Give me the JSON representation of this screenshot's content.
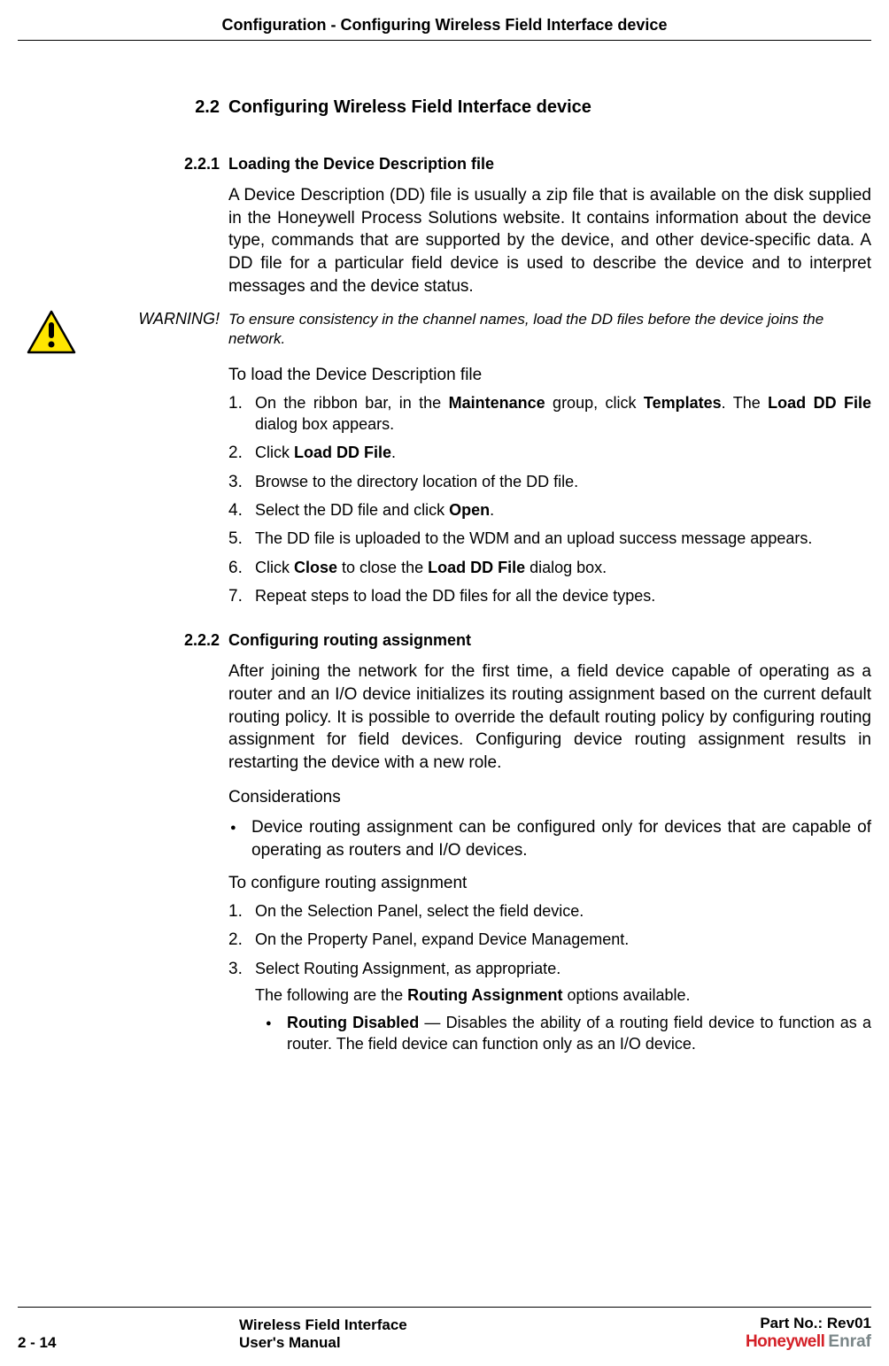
{
  "header": {
    "title": "Configuration - Configuring Wireless Field Interface device"
  },
  "section_2_2": {
    "number": "2.2",
    "title": "Configuring Wireless Field Interface device"
  },
  "section_2_2_1": {
    "number": "2.2.1",
    "title": "Loading the Device Description file",
    "para": "A Device Description (DD) file is usually a zip file that is available on the disk supplied in the Honeywell Process Solutions website. It contains information about the device type, commands that are supported by the device, and other device-specific data. A DD file for a particular field device is used to describe the device and to interpret messages and the device status.",
    "warning_label": "WARNING!",
    "warning_text": "To ensure consistency in the channel names, load the DD files before the device joins the network.",
    "lead": "To load the Device Description file",
    "steps": {
      "s1_a": "On the ribbon bar, in the ",
      "s1_b": "Maintenance",
      "s1_c": " group, click ",
      "s1_d": "Templates",
      "s1_e": ". The ",
      "s1_f": "Load DD File",
      "s1_g": " dialog box appears.",
      "s2_a": "Click ",
      "s2_b": "Load DD File",
      "s2_c": ".",
      "s3": "Browse to the directory location of the DD file.",
      "s4_a": "Select the DD file and click ",
      "s4_b": "Open",
      "s4_c": ".",
      "s5": "The DD file is uploaded to the WDM and an upload success message appears.",
      "s6_a": "Click ",
      "s6_b": "Close",
      "s6_c": " to close the ",
      "s6_d": "Load DD File",
      "s6_e": " dialog box.",
      "s7": "Repeat steps to load the DD files for all the device types."
    }
  },
  "section_2_2_2": {
    "number": "2.2.2",
    "title": "Configuring routing assignment",
    "para": "After joining the network for the first time, a field device capable of operating as a router and an I/O device initializes its routing assignment based on the current default routing policy. It is possible to override the default routing policy by configuring routing assignment for field devices. Configuring device routing assignment results in restarting the device with a new role.",
    "considerations_label": "Considerations",
    "consideration_bullet": "Device routing assignment can be configured only for devices that are capable of operating as routers and I/O devices.",
    "lead": "To configure routing assignment",
    "steps": {
      "s1": "On the Selection Panel, select the field device.",
      "s2": "On the Property Panel, expand Device Management.",
      "s3": "Select Routing Assignment, as appropriate."
    },
    "follow_a": "The following are the ",
    "follow_b": "Routing Assignment",
    "follow_c": " options available.",
    "opt_a": "Routing Disabled",
    "opt_b": " — Disables the ability of a routing field device to function as a router. The field device can function only as an I/O device."
  },
  "footer": {
    "page": "2 - 14",
    "center_line1": "Wireless Field Interface",
    "center_line2": "User's Manual",
    "right_line1": "Part No.: Rev01",
    "brand1": "Honeywell",
    "brand2": "Enraf"
  }
}
